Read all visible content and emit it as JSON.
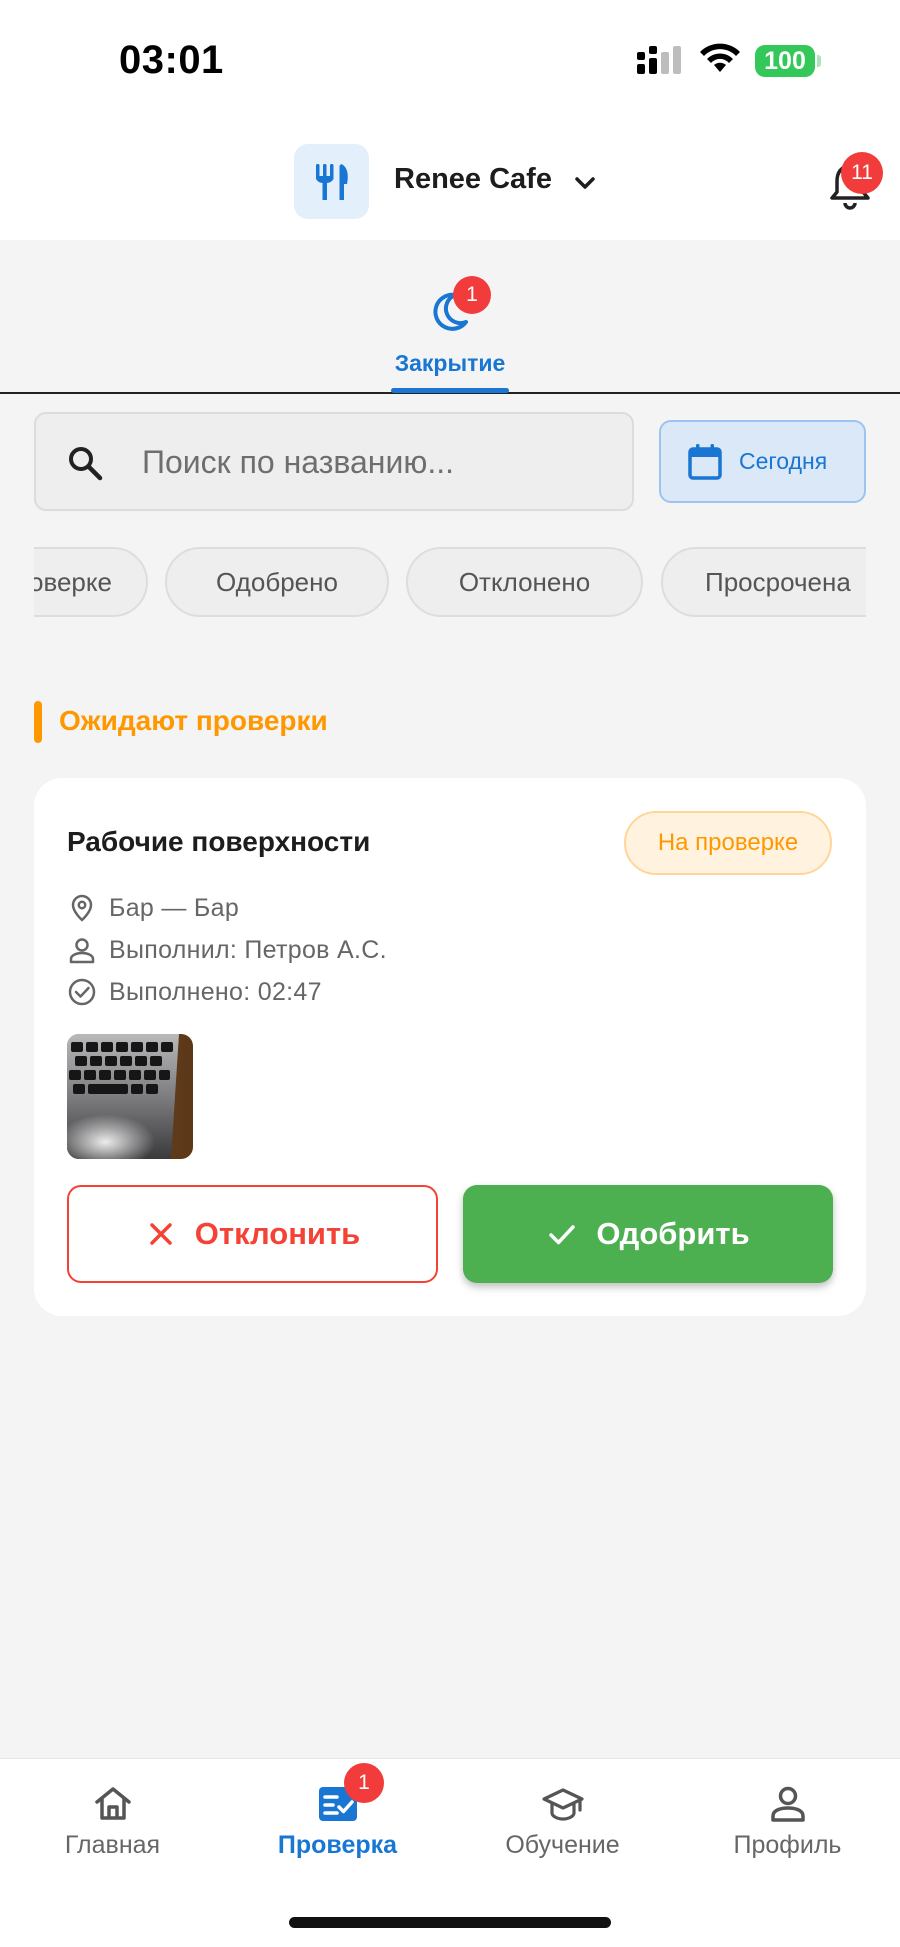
{
  "status_bar": {
    "time": "03:01",
    "battery": "100"
  },
  "header": {
    "venue_name": "Renee Cafe",
    "venue_icon": "fork-knife-icon",
    "notifications_count": "11"
  },
  "shift_tab": {
    "label": "Закрытие",
    "badge": "1",
    "icon": "moon-icon"
  },
  "search": {
    "placeholder": "Поиск по названию...",
    "value": ""
  },
  "date_filter": {
    "label": "Сегодня"
  },
  "status_filters": [
    {
      "label": "На проверке"
    },
    {
      "label": "Одобрено"
    },
    {
      "label": "Отклонено"
    },
    {
      "label": "Просрочена"
    }
  ],
  "section": {
    "title": "Ожидают проверки"
  },
  "task_card": {
    "title": "Рабочие поверхности",
    "status": "На проверке",
    "location": "Бар — Бар",
    "performer": "Выполнил: Петров А.С.",
    "completed": "Выполнено: 02:47",
    "reject_label": "Отклонить",
    "approve_label": "Одобрить"
  },
  "bottom_nav": [
    {
      "label": "Главная",
      "icon": "home-icon"
    },
    {
      "label": "Проверка",
      "icon": "checklist-icon",
      "badge": "1",
      "active": true
    },
    {
      "label": "Обучение",
      "icon": "graduation-cap-icon"
    },
    {
      "label": "Профиль",
      "icon": "person-icon"
    }
  ],
  "colors": {
    "primary": "#1976d2",
    "pending": "#ff9800",
    "reject": "#f44336",
    "approve": "#4caf50",
    "badge": "#f23b3b"
  }
}
